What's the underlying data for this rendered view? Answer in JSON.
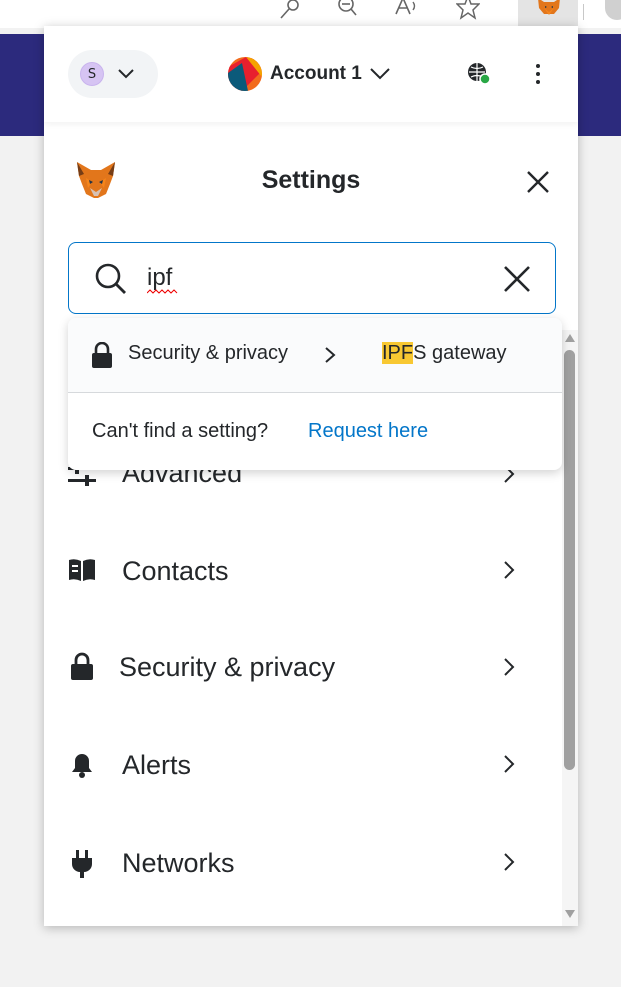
{
  "app": {
    "title": "Settings"
  },
  "header": {
    "network_initial": "S",
    "account_name": "Account 1"
  },
  "search": {
    "value": "ipf",
    "placeholder": "Search"
  },
  "dropdown": {
    "result_section": "Security & privacy",
    "result_setting_highlight": "IPF",
    "result_setting_rest": "S gateway",
    "cant_find": "Can't find a setting?",
    "request_link": "Request here"
  },
  "menu": {
    "items": [
      {
        "label": "Advanced",
        "icon": "sliders-icon"
      },
      {
        "label": "Contacts",
        "icon": "book-icon"
      },
      {
        "label": "Security & privacy",
        "icon": "lock-icon"
      },
      {
        "label": "Alerts",
        "icon": "bell-icon"
      },
      {
        "label": "Networks",
        "icon": "plug-icon"
      }
    ]
  },
  "colors": {
    "accent": "#0376c9",
    "highlight": "#f8c832",
    "connected": "#28a745",
    "page_band": "#2c2a7d"
  }
}
